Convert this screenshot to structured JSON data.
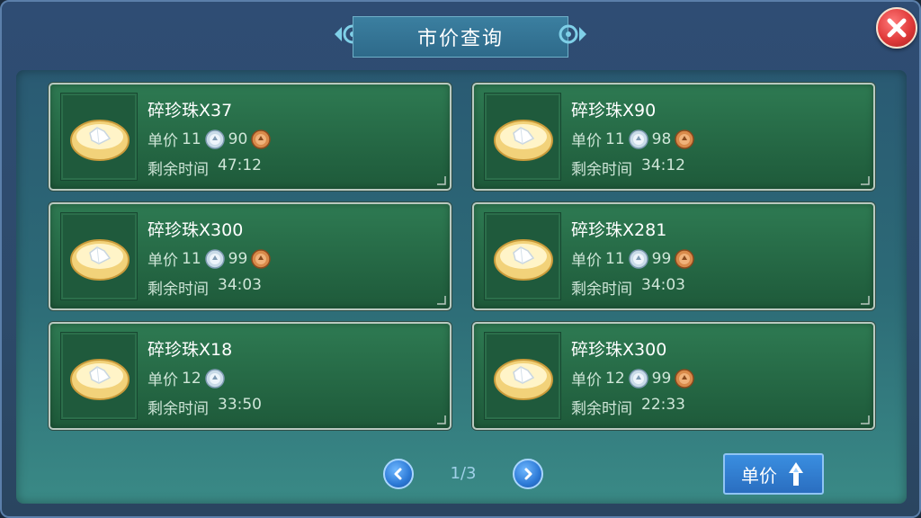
{
  "window": {
    "title": "市价查询"
  },
  "listings": [
    {
      "name": "碎珍珠X37",
      "price_label": "单价",
      "silver": "11",
      "copper": "90",
      "time_label": "剩余时间",
      "time": "47:12"
    },
    {
      "name": "碎珍珠X90",
      "price_label": "单价",
      "silver": "11",
      "copper": "98",
      "time_label": "剩余时间",
      "time": "34:12"
    },
    {
      "name": "碎珍珠X300",
      "price_label": "单价",
      "silver": "11",
      "copper": "99",
      "time_label": "剩余时间",
      "time": "34:03"
    },
    {
      "name": "碎珍珠X281",
      "price_label": "单价",
      "silver": "11",
      "copper": "99",
      "time_label": "剩余时间",
      "time": "34:03"
    },
    {
      "name": "碎珍珠X18",
      "price_label": "单价",
      "silver": "12",
      "copper": null,
      "time_label": "剩余时间",
      "time": "33:50"
    },
    {
      "name": "碎珍珠X300",
      "price_label": "单价",
      "silver": "12",
      "copper": "99",
      "time_label": "剩余时间",
      "time": "22:33"
    }
  ],
  "pagination": {
    "page": "1/3"
  },
  "sort_button": {
    "label": "单价",
    "icon": "sort-up-icon"
  },
  "icons": {
    "close": "close-icon",
    "prev": "chevron-left-icon",
    "next": "chevron-right-icon",
    "item": "pearl-shell-icon",
    "silver": "silver-coin-icon",
    "copper": "copper-coin-icon"
  },
  "colors": {
    "card_green": "#2e7a52",
    "close_red": "#e03a3a",
    "button_blue": "#2c79d6"
  }
}
